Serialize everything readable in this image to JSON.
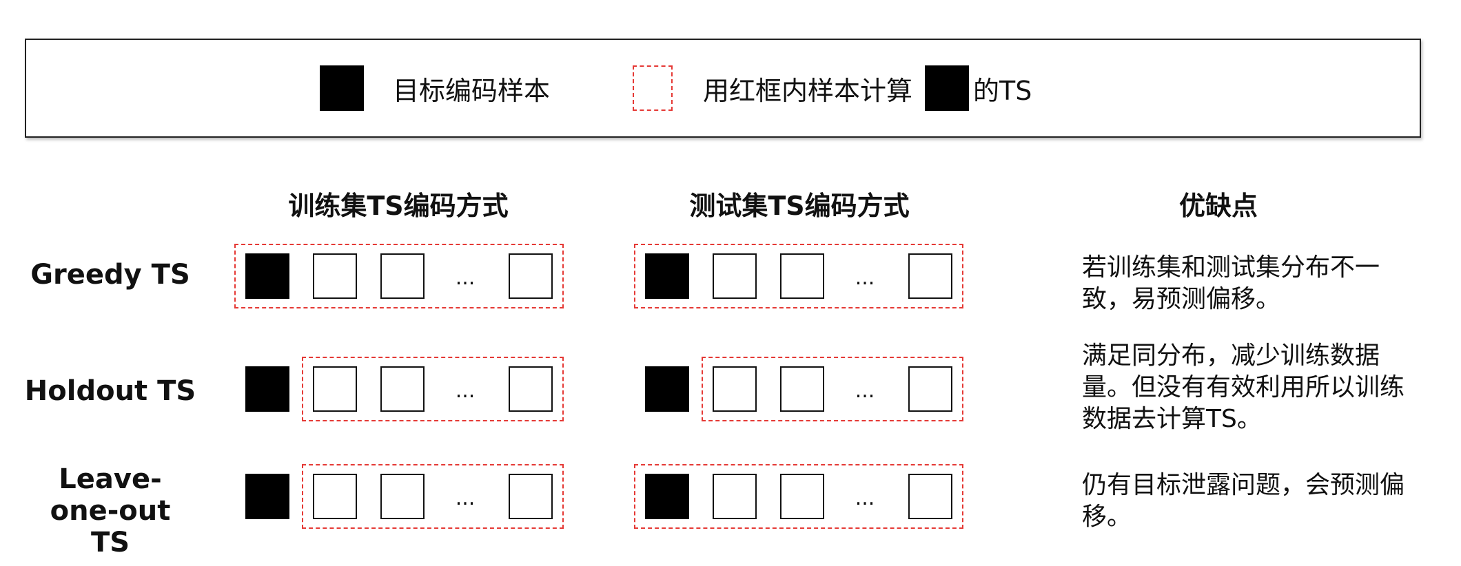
{
  "legend": {
    "target_label": "目标编码样本",
    "redbox_label": "用红框内样本计算",
    "ts_suffix": "的TS"
  },
  "headers": {
    "train": "训练集TS编码方式",
    "test": "测试集TS编码方式",
    "proscons": "优缺点"
  },
  "ellipsis": "...",
  "rows": [
    {
      "label": "Greedy TS",
      "train_box": "all",
      "test_box": "all",
      "proscons": "若训练集和测试集分布不一致，易预测偏移。"
    },
    {
      "label": "Holdout TS",
      "train_box": "others",
      "test_box": "others",
      "proscons": "满足同分布，减少训练数据量。但没有有效利用所以训练数据去计算TS。"
    },
    {
      "label": "Leave-one-out TS",
      "train_box": "others",
      "test_box": "all",
      "proscons": "仍有目标泄露问题，会预测偏移。"
    }
  ],
  "colors": {
    "target_fill": "#000000",
    "dash_red": "#e53935",
    "border": "#222222"
  }
}
